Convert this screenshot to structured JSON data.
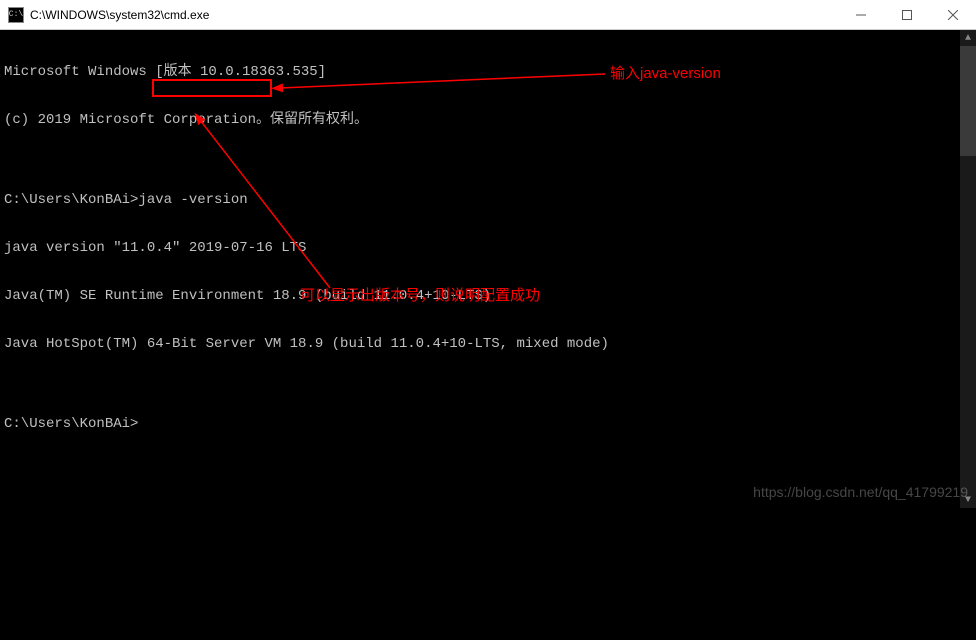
{
  "titlebar": {
    "title": "C:\\WINDOWS\\system32\\cmd.exe",
    "icon_label": "cmd"
  },
  "terminal": {
    "line1": "Microsoft Windows [版本 10.0.18363.535]",
    "line2": "(c) 2019 Microsoft Corporation。保留所有权利。",
    "line3": "",
    "prompt1_path": "C:\\Users\\KonBAi>",
    "command": "java -version",
    "line5": "java version \"11.0.4\" 2019-07-16 LTS",
    "line6": "Java(TM) SE Runtime Environment 18.9 (build 11.0.4+10-LTS)",
    "line7": "Java HotSpot(TM) 64-Bit Server VM 18.9 (build 11.0.4+10-LTS, mixed mode)",
    "line8": "",
    "prompt2": "C:\\Users\\KonBAi>"
  },
  "annotations": {
    "input_hint": "输入java-version",
    "success_hint": "可以显示出版本号，则说明配置成功"
  },
  "watermark": "https://blog.csdn.net/qq_41799219",
  "colors": {
    "annotation": "#ff0000",
    "terminal_fg": "#c0c0c0",
    "terminal_bg": "#000000"
  }
}
